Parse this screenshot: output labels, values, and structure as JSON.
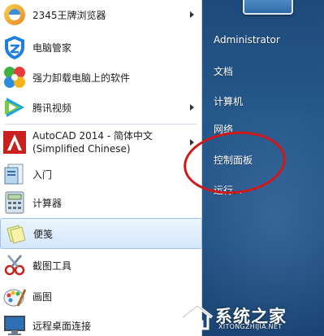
{
  "programs": [
    {
      "label": "2345王牌浏览器",
      "has_submenu": true,
      "icon": "browser-2345-icon"
    },
    {
      "label": "电脑管家",
      "has_submenu": false,
      "icon": "tencent-pc-manager-icon"
    },
    {
      "label": "强力卸载电脑上的软件",
      "has_submenu": false,
      "icon": "uninstaller-icon"
    },
    {
      "label": "腾讯视频",
      "has_submenu": true,
      "icon": "tencent-video-icon"
    },
    {
      "label_line1": "AutoCAD 2014 - 简体中文",
      "label_line2": "(Simplified Chinese)",
      "has_submenu": true,
      "icon": "autocad-icon"
    },
    {
      "label": "入门",
      "has_submenu": false,
      "icon": "getting-started-icon"
    },
    {
      "label": "计算器",
      "has_submenu": false,
      "icon": "calculator-icon"
    },
    {
      "label": "便笺",
      "has_submenu": false,
      "highlighted": true,
      "icon": "sticky-notes-icon"
    },
    {
      "label": "截图工具",
      "has_submenu": false,
      "icon": "snipping-tool-icon"
    },
    {
      "label": "画图",
      "has_submenu": false,
      "icon": "paint-icon"
    },
    {
      "label": "远程桌面连接",
      "has_submenu": false,
      "icon": "remote-desktop-icon"
    }
  ],
  "right_panel": {
    "user": "Administrator",
    "documents": "文档",
    "computer": "计算机",
    "network": "网络",
    "control_panel": "控制面板",
    "run": "运行..."
  },
  "watermark": {
    "title": "系统之家",
    "url": "XITONGZHIJIA.NET"
  },
  "colors": {
    "right_panel": "#26588c",
    "highlight": "#d4e7fb",
    "annotation": "#d11818"
  }
}
